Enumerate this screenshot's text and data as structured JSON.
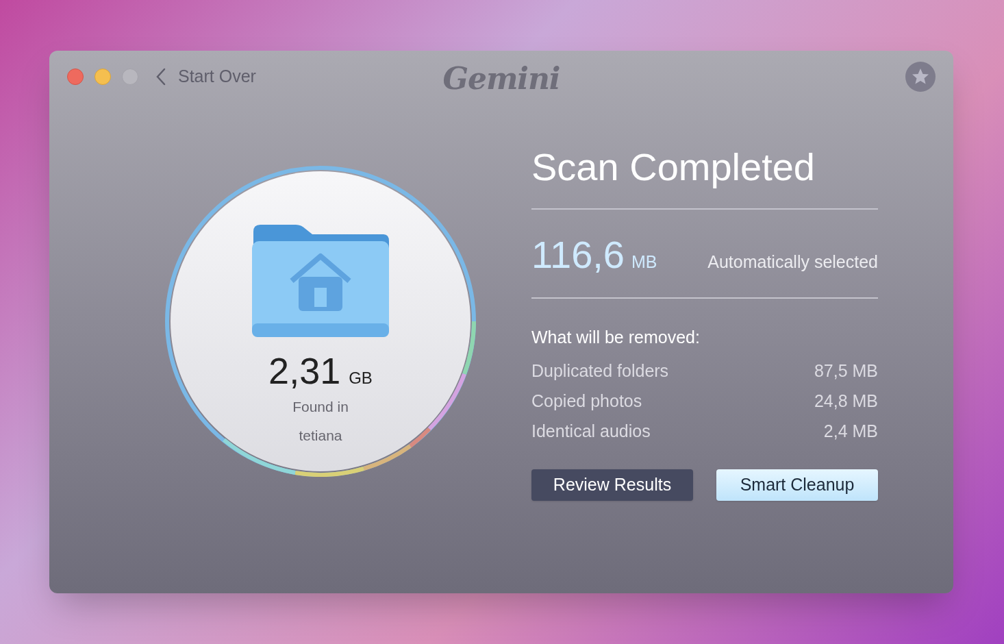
{
  "window": {
    "title": "Gemini",
    "back_label": "Start Over"
  },
  "summary": {
    "size": "2,31",
    "unit": "GB",
    "caption": "Found in",
    "folder": "tetiana"
  },
  "result": {
    "heading": "Scan Completed",
    "size": "116,6",
    "unit": "MB",
    "note": "Automatically selected"
  },
  "removed": {
    "heading": "What will be removed:",
    "rows": [
      {
        "label": "Duplicated folders",
        "value": "87,5 MB"
      },
      {
        "label": "Copied photos",
        "value": "24,8 MB"
      },
      {
        "label": "Identical audios",
        "value": "2,4 MB"
      }
    ]
  },
  "buttons": [
    {
      "label": "Review Results",
      "kind": "secondary"
    },
    {
      "label": "Smart Cleanup",
      "kind": "primary"
    }
  ]
}
